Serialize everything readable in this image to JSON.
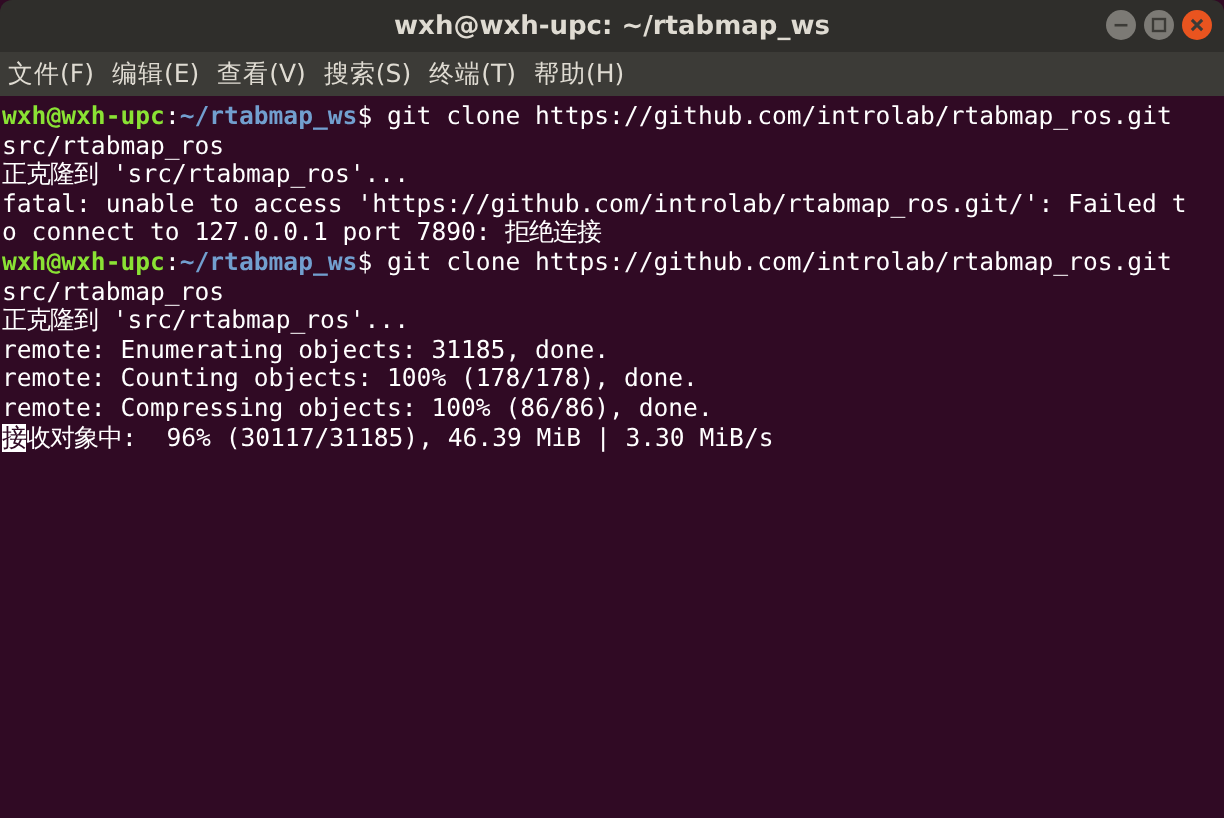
{
  "window": {
    "title": "wxh@wxh-upc: ~/rtabmap_ws"
  },
  "menu": [
    "文件(F)",
    "编辑(E)",
    "查看(V)",
    "搜索(S)",
    "终端(T)",
    "帮助(H)"
  ],
  "terminal": {
    "lines": [
      {
        "kind": "prompt",
        "user": "wxh@wxh-upc",
        "sep": ":",
        "path": "~/rtabmap_ws",
        "text": "$ git clone https://github.com/introlab/rtabmap_ros.git"
      },
      {
        "kind": "output",
        "text": "src/rtabmap_ros"
      },
      {
        "kind": "output",
        "text": "正克隆到 'src/rtabmap_ros'..."
      },
      {
        "kind": "output",
        "text": "fatal: unable to access 'https://github.com/introlab/rtabmap_ros.git/': Failed t"
      },
      {
        "kind": "output",
        "text": "o connect to 127.0.0.1 port 7890: 拒绝连接"
      },
      {
        "kind": "prompt",
        "user": "wxh@wxh-upc",
        "sep": ":",
        "path": "~/rtabmap_ws",
        "text": "$ git clone https://github.com/introlab/rtabmap_ros.git"
      },
      {
        "kind": "output",
        "text": "src/rtabmap_ros"
      },
      {
        "kind": "output",
        "text": "正克隆到 'src/rtabmap_ros'..."
      },
      {
        "kind": "output",
        "text": "remote: Enumerating objects: 31185, done."
      },
      {
        "kind": "output",
        "text": "remote: Counting objects: 100% (178/178), done."
      },
      {
        "kind": "output",
        "text": "remote: Compressing objects: 100% (86/86), done."
      },
      {
        "kind": "cursor",
        "cursor_char": "接",
        "text": "收对象中:  96% (30117/31185), 46.39 MiB | 3.30 MiB/s"
      }
    ]
  }
}
